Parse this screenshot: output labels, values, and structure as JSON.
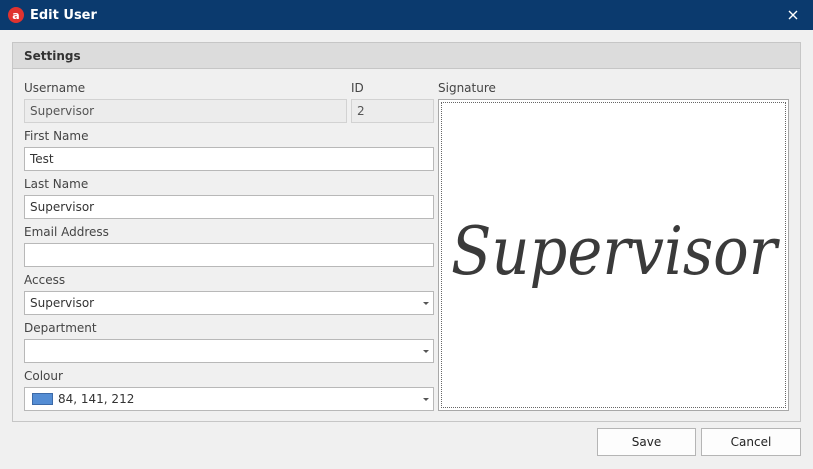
{
  "window": {
    "title": "Edit User",
    "app_icon_letter": "a"
  },
  "group": {
    "title": "Settings"
  },
  "form": {
    "username_label": "Username",
    "username_value": "Supervisor",
    "id_label": "ID",
    "id_value": "2",
    "signature_label": "Signature",
    "first_name_label": "First Name",
    "first_name_value": "Test",
    "last_name_label": "Last Name",
    "last_name_value": "Supervisor",
    "email_label": "Email Address",
    "email_value": "",
    "access_label": "Access",
    "access_value": "Supervisor",
    "department_label": "Department",
    "department_value": "",
    "colour_label": "Colour",
    "colour_value": "84, 141, 212",
    "colour_hex": "#548dd4"
  },
  "signature": {
    "text": "Supervisor"
  },
  "buttons": {
    "save": "Save",
    "cancel": "Cancel"
  },
  "icons": {
    "app": "app-logo-icon",
    "close": "close-icon",
    "dropdown": "chevron-down-icon"
  }
}
